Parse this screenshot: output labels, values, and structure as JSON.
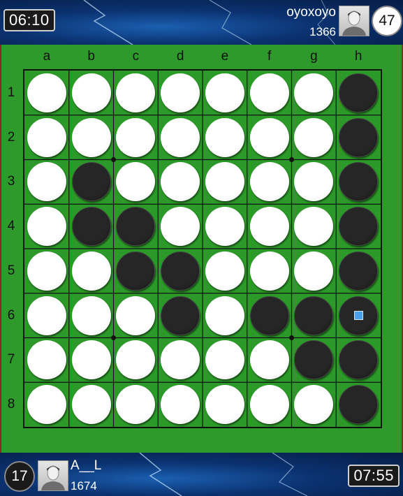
{
  "top_player": {
    "timer": "06:10",
    "name": "oyoxoyo",
    "rating": "1366",
    "disc_count": "47",
    "disc_color": "white"
  },
  "bottom_player": {
    "timer": "07:55",
    "name": "A__L",
    "rating": "1674",
    "disc_count": "17",
    "disc_color": "black"
  },
  "board": {
    "columns": [
      "a",
      "b",
      "c",
      "d",
      "e",
      "f",
      "g",
      "h"
    ],
    "rows": [
      "1",
      "2",
      "3",
      "4",
      "5",
      "6",
      "7",
      "8"
    ],
    "cells": [
      "WWWWWWWB",
      "WWWWWWWB",
      "WBWWWWWB",
      "WBBWWWWB",
      "WWBBWWWB",
      "WWWBWBBB",
      "WWWWWWBB",
      "WWWWWWWB"
    ],
    "last_move": "h6",
    "colors": {
      "board": "#2c9a28",
      "white_disc": "#ffffff",
      "black_disc": "#1a1a1a",
      "last_move_marker": "#4aa0ea"
    }
  }
}
